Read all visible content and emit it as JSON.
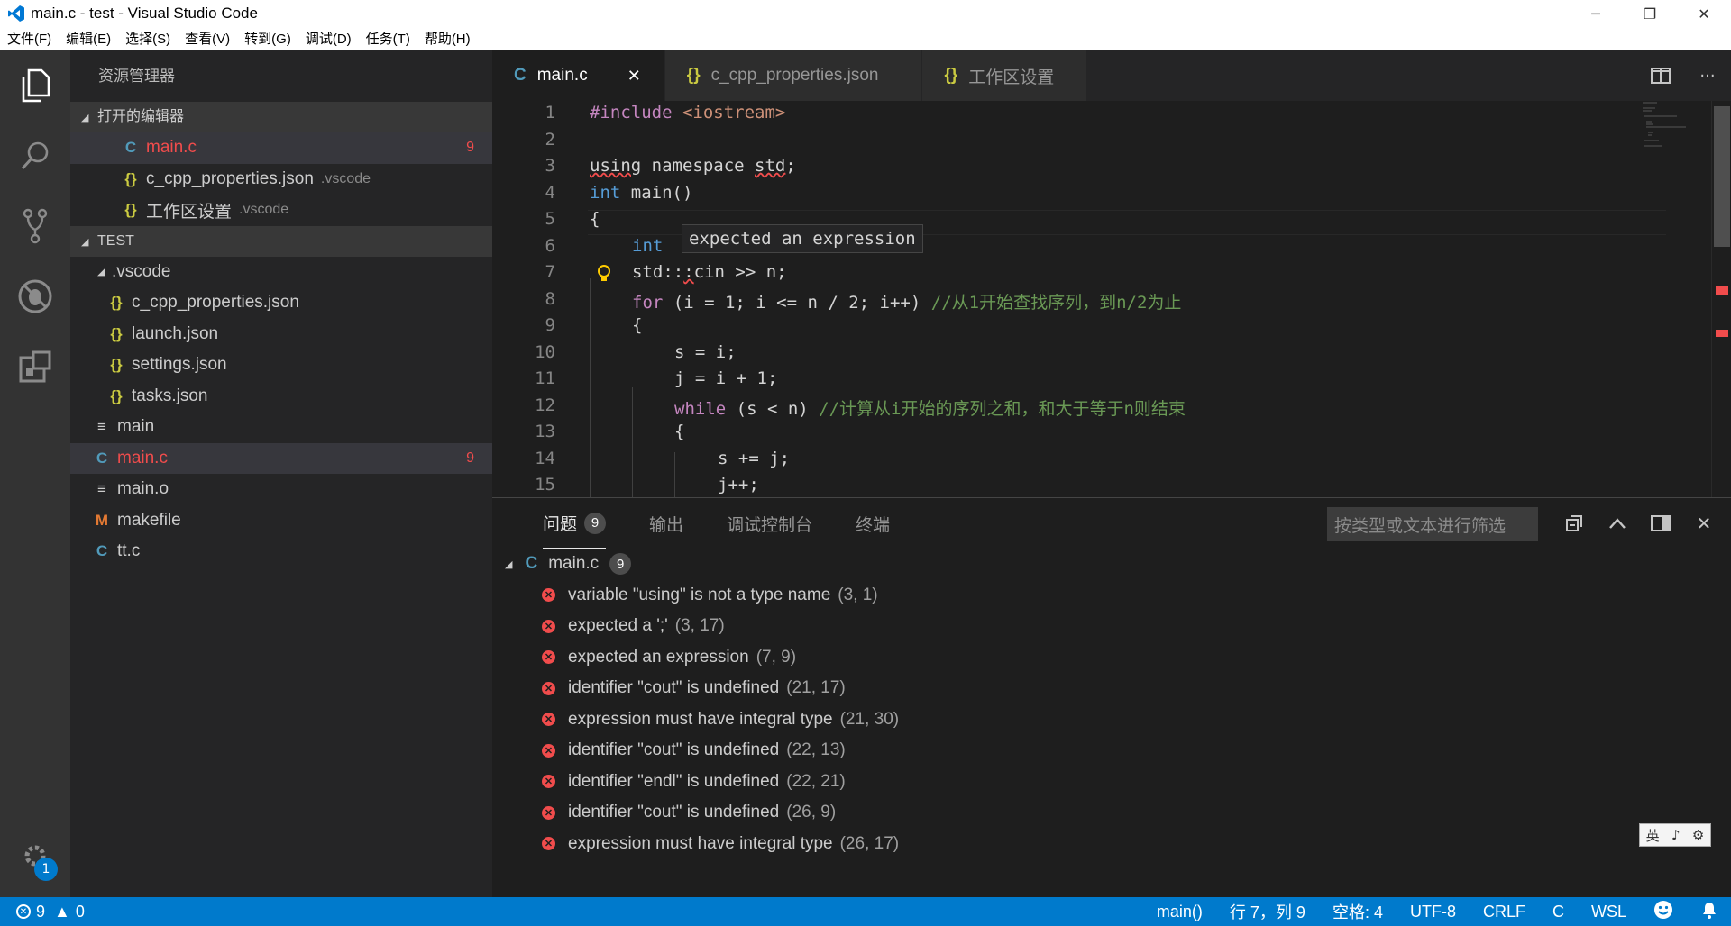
{
  "window": {
    "title": "main.c - test - Visual Studio Code",
    "min_glyph": "─",
    "max_glyph": "❐",
    "close_glyph": "✕"
  },
  "menu": [
    "文件(F)",
    "编辑(E)",
    "选择(S)",
    "查看(V)",
    "转到(G)",
    "调试(D)",
    "任务(T)",
    "帮助(H)"
  ],
  "activity": {
    "settings_badge": "1"
  },
  "sidebar": {
    "title": "资源管理器",
    "open_editors": {
      "label": "打开的编辑器",
      "items": [
        {
          "icon": "C",
          "name": "main.c",
          "desc": "",
          "count": "9"
        },
        {
          "icon": "{}",
          "name": "c_cpp_properties.json",
          "desc": ".vscode",
          "count": ""
        },
        {
          "icon": "{}",
          "name": "工作区设置",
          "desc": ".vscode",
          "count": ""
        }
      ]
    },
    "project": {
      "label": "TEST",
      "folder": ".vscode",
      "folder_items": [
        "c_cpp_properties.json",
        "launch.json",
        "settings.json",
        "tasks.json"
      ],
      "files": [
        {
          "icon": "≡",
          "name": "main",
          "count": ""
        },
        {
          "icon": "C",
          "name": "main.c",
          "count": "9"
        },
        {
          "icon": "≡",
          "name": "main.o",
          "count": ""
        },
        {
          "icon": "M",
          "name": "makefile",
          "count": ""
        },
        {
          "icon": "C",
          "name": "tt.c",
          "count": ""
        }
      ]
    }
  },
  "tabs": [
    {
      "icon": "C",
      "label": "main.c",
      "close": "✕"
    },
    {
      "icon": "{}",
      "label": "c_cpp_properties.json"
    },
    {
      "icon": "{}",
      "label": "工作区设置"
    }
  ],
  "editor": {
    "line_numbers": [
      "1",
      "2",
      "3",
      "4",
      "5",
      "6",
      "7",
      "8",
      "9",
      "10",
      "11",
      "12",
      "13",
      "14",
      "15"
    ],
    "l1_a": "#include",
    "l1_b": "<iostream>",
    "l3_a": "using",
    "l3_b": " namespace ",
    "l3_c": "std",
    "l3_d": ";",
    "l4_a": "int",
    "l4_b": " main()",
    "l5": "{",
    "l6_a": "int",
    "l7_a": "std::",
    "l7_b": ":",
    "l7_c": "cin >> n;",
    "l8_a": "for",
    "l8_b": " (i = 1; i <= n / 2; i++) ",
    "l8_c": "//从1开始查找序列，到n/2为止",
    "l9": "{",
    "l10": "s = i;",
    "l11": "j = i + 1;",
    "l12_a": "while",
    "l12_b": " (s < n) ",
    "l12_c": "//计算从i开始的序列之和，和大于等于n则结束",
    "l13": "{",
    "l14": "s += j;",
    "l15": "j++;",
    "hover": "expected an expression"
  },
  "panel": {
    "tabs": [
      {
        "label": "问题",
        "badge": "9"
      },
      {
        "label": "输出"
      },
      {
        "label": "调试控制台"
      },
      {
        "label": "终端"
      }
    ],
    "filter_placeholder": "按类型或文本进行筛选",
    "file": {
      "name": "main.c",
      "count": "9"
    },
    "problems": [
      {
        "msg": "variable \"using\" is not a type name",
        "loc": "(3, 1)"
      },
      {
        "msg": "expected a ';'",
        "loc": "(3, 17)"
      },
      {
        "msg": "expected an expression",
        "loc": "(7, 9)"
      },
      {
        "msg": "identifier \"cout\" is undefined",
        "loc": "(21, 17)"
      },
      {
        "msg": "expression must have integral type",
        "loc": "(21, 30)"
      },
      {
        "msg": "identifier \"cout\" is undefined",
        "loc": "(22, 13)"
      },
      {
        "msg": "identifier \"endl\" is undefined",
        "loc": "(22, 21)"
      },
      {
        "msg": "identifier \"cout\" is undefined",
        "loc": "(26, 9)"
      },
      {
        "msg": "expression must have integral type",
        "loc": "(26, 17)"
      }
    ]
  },
  "status": {
    "errors": "9",
    "warnings": "0",
    "function": "main()",
    "position": "行 7，列 9",
    "spaces": "空格: 4",
    "encoding": "UTF-8",
    "eol": "CRLF",
    "language": "C",
    "platform": "WSL"
  },
  "ime": {
    "a": "英",
    "b": "♪",
    "c": "⚙"
  },
  "colors": {
    "accent": "#007acc",
    "error": "#f14c4c",
    "editor_bg": "#1e1e1e"
  }
}
